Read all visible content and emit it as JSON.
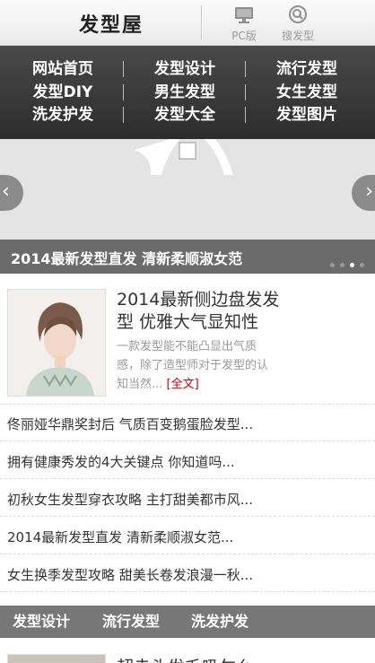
{
  "header": {
    "logo": "发型屋",
    "pc_label": "PC版",
    "search_label": "搜发型"
  },
  "nav": {
    "items": [
      "网站首页",
      "发型设计",
      "流行发型",
      "发型DIY",
      "男生发型",
      "女生发型",
      "洗发护发",
      "发型大全",
      "发型图片"
    ]
  },
  "slider": {
    "caption": "2014最新发型直发 清新柔顺淑女范",
    "prev_icon": "chevron-left-icon",
    "next_icon": "chevron-right-icon",
    "dots": 4,
    "active_dot": 3
  },
  "featured": {
    "title": "2014最新侧边盘发发型 优雅大气显知性",
    "desc": "一款发型能不能凸显出气质感，除了造型师对于发型的认知当然...",
    "more": "[全文]"
  },
  "list": [
    "佟丽娅华鼎奖封后 气质百变鹅蛋脸发型...",
    "拥有健康秀发的4大关键点 你知道吗...",
    "初秋女生发型穿衣攻略 主打甜美都市风...",
    "2014最新发型直发 清新柔顺淑女范...",
    "女生换季发型攻略 甜美长卷发浪漫一秋..."
  ],
  "categories": [
    "发型设计",
    "流行发型",
    "洗发护发"
  ],
  "next_title": "超赤头发毛吸乍么"
}
